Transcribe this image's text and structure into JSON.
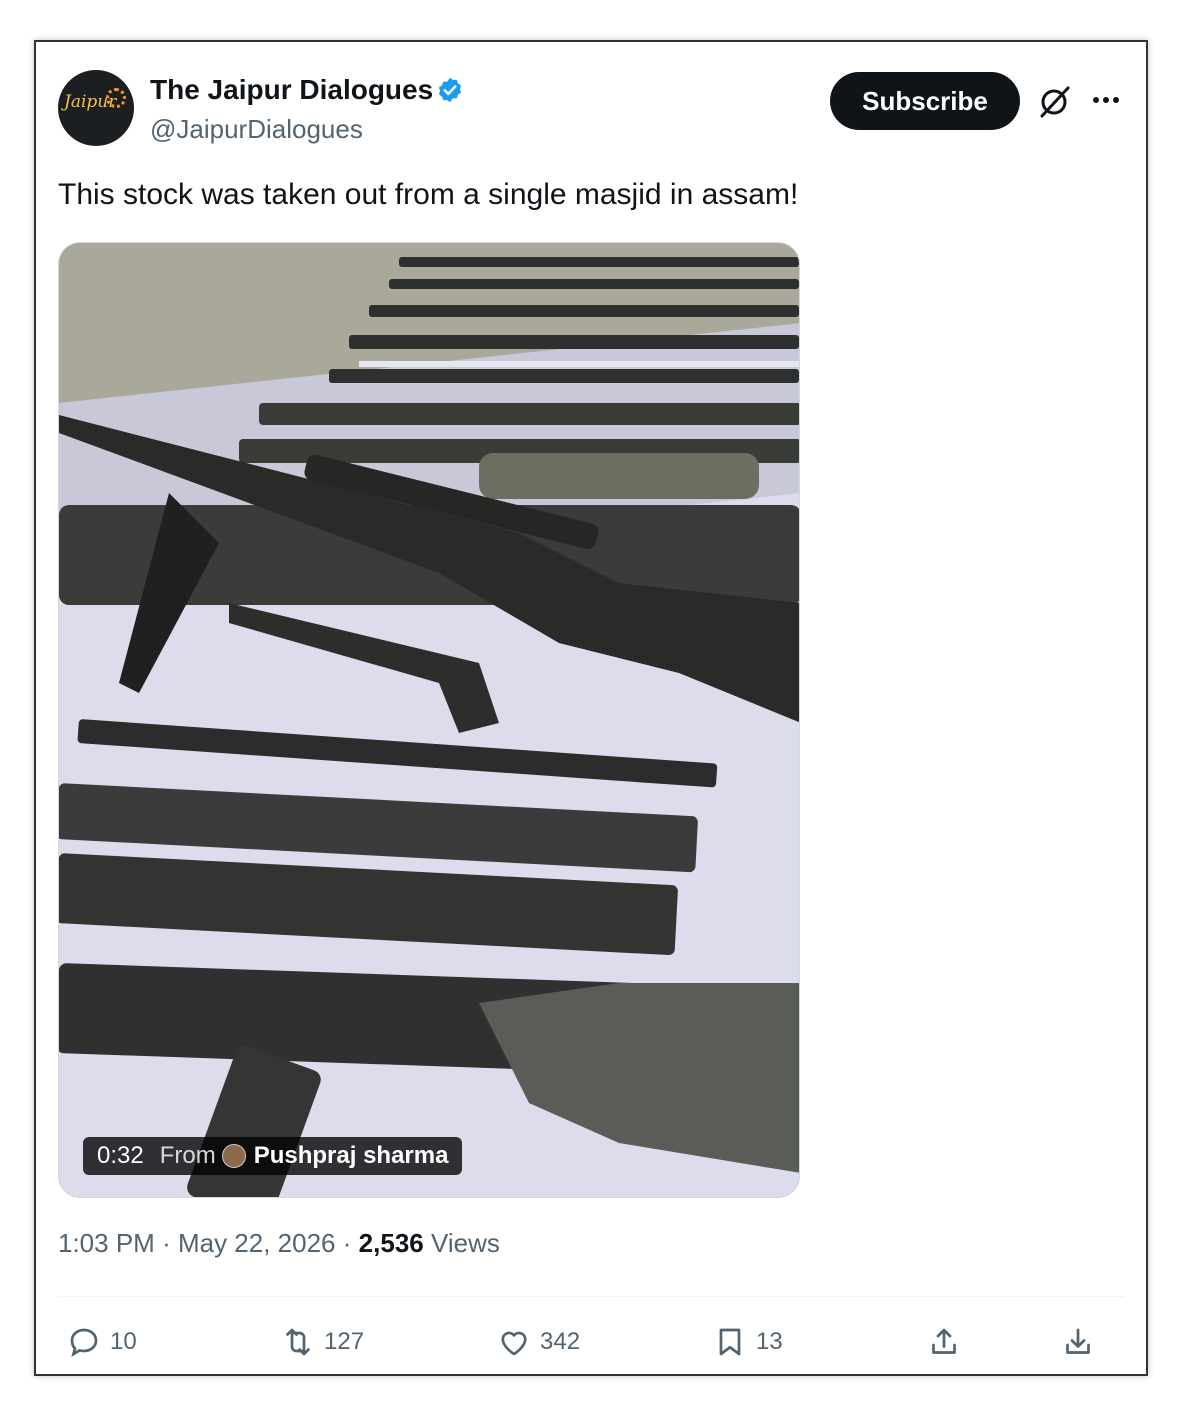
{
  "author": {
    "name": "The Jaipur Dialogues",
    "handle": "@JaipurDialogues",
    "avatar_text": "Jaipur"
  },
  "header": {
    "subscribe_label": "Subscribe"
  },
  "tweet": {
    "text": "This stock was taken out from a single masjid in assam!"
  },
  "video": {
    "duration": "0:32",
    "from_label": "From",
    "from_name": "Pushpraj sharma"
  },
  "meta": {
    "time": "1:03 PM",
    "separator": "·",
    "date": "May 22, 2026",
    "views_count": "2,536",
    "views_label": "Views"
  },
  "actions": {
    "replies": "10",
    "reposts": "127",
    "likes": "342",
    "bookmarks": "13"
  },
  "icons": {
    "verified": "verified-badge-icon",
    "grok": "grok-icon",
    "more": "more-icon",
    "reply": "reply-icon",
    "repost": "repost-icon",
    "like": "heart-icon",
    "bookmark": "bookmark-icon",
    "share": "share-icon",
    "download": "download-icon"
  },
  "colors": {
    "verified": "#1d9bf0",
    "text": "#0f1419",
    "secondary": "#536471"
  }
}
